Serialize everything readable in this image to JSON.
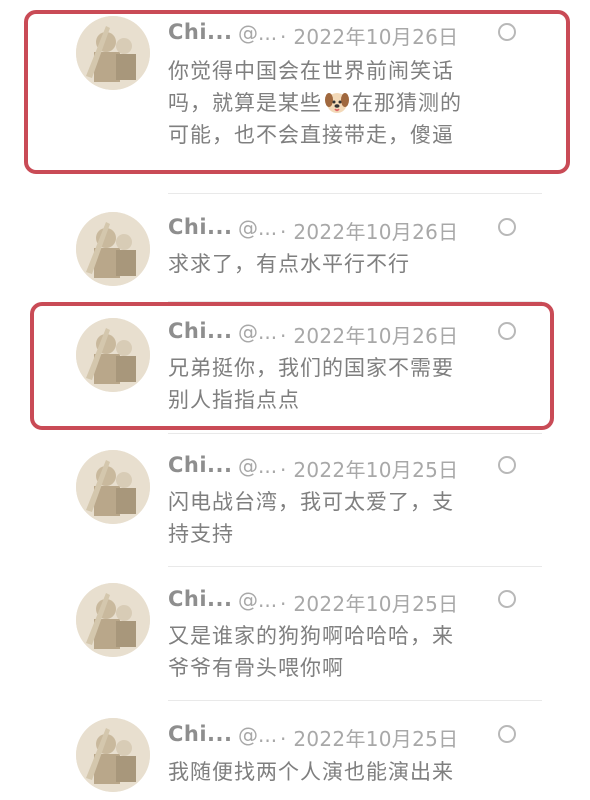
{
  "posts": [
    {
      "name": "Chi...",
      "handle": "@...",
      "date": "2022年10月26日",
      "text_before": "你觉得中国会在世界前闹笑话吗，就算是某些",
      "emoji": "dog-face",
      "text_after": "在那猜测的可能，也不会直接带走，傻逼"
    },
    {
      "name": "Chi...",
      "handle": "@...",
      "date": "2022年10月26日",
      "text": "求求了，有点水平行不行"
    },
    {
      "name": "Chi...",
      "handle": "@...",
      "date": "2022年10月26日",
      "text": "兄弟挺你，我们的国家不需要别人指指点点"
    },
    {
      "name": "Chi...",
      "handle": "@...",
      "date": "2022年10月25日",
      "text": "闪电战台湾，我可太爱了，支持支持"
    },
    {
      "name": "Chi...",
      "handle": "@...",
      "date": "2022年10月25日",
      "text": "又是谁家的狗狗啊哈哈哈，来爷爷有骨头喂你啊"
    },
    {
      "name": "Chi...",
      "handle": "@...",
      "date": "2022年10月25日",
      "text": "我随便找两个人演也能演出来"
    }
  ],
  "separator": "·",
  "highlight_color": "#c94b56"
}
